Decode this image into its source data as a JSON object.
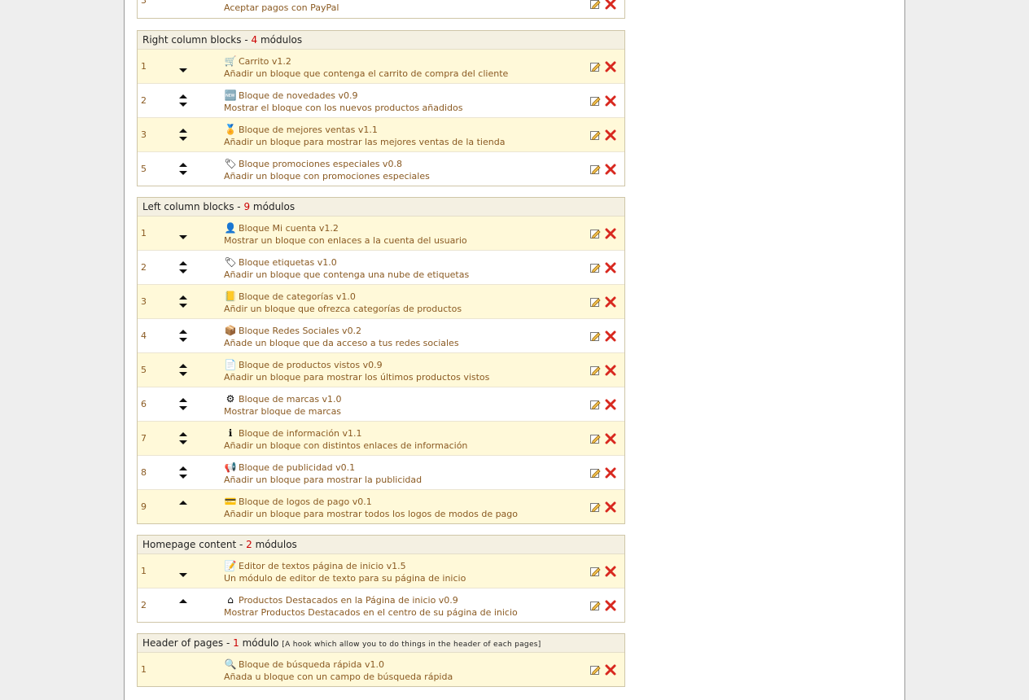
{
  "top_partial": {
    "position": "3",
    "description": "Aceptar pagos con PayPal"
  },
  "blocks": [
    {
      "title": "Right column blocks",
      "sep": " - ",
      "count": "4",
      "unit": "módulos",
      "hook_desc": "",
      "rows": [
        {
          "pos": "1",
          "icon": "cart-icon",
          "name": "Carrito v1.2",
          "desc": "Añadir un bloque que contenga el carrito de compra del cliente",
          "up": false,
          "down": true
        },
        {
          "pos": "2",
          "icon": "new-badge-icon",
          "name": "Bloque de novedades v0.9",
          "desc": "Mostrar el bloque con los nuevos productos añadidos",
          "up": true,
          "down": true
        },
        {
          "pos": "3",
          "icon": "award-icon",
          "name": "Bloque de mejores ventas v1.1",
          "desc": "Añadir un bloque para mostrar las mejores ventas de la tienda",
          "up": true,
          "down": true
        },
        {
          "pos": "5",
          "icon": "tag-icon",
          "name": "Bloque promociones especiales v0.8",
          "desc": "Añadir un bloque con promociones especiales",
          "up": true,
          "down": true
        }
      ]
    },
    {
      "title": "Left column blocks",
      "sep": " - ",
      "count": "9",
      "unit": "módulos",
      "hook_desc": "",
      "rows": [
        {
          "pos": "1",
          "icon": "user-icon",
          "name": "Bloque Mi cuenta v1.2",
          "desc": "Mostrar un bloque con enlaces a la cuenta del usuario",
          "up": false,
          "down": true
        },
        {
          "pos": "2",
          "icon": "tags-icon",
          "name": "Bloque etiquetas v1.0",
          "desc": "Añadir un bloque que contenga una nube de etiquetas",
          "up": true,
          "down": true
        },
        {
          "pos": "3",
          "icon": "catalog-icon",
          "name": "Bloque de categorías v1.0",
          "desc": "Añdir un bloque que ofrezca categorías de productos",
          "up": true,
          "down": true
        },
        {
          "pos": "4",
          "icon": "cube-icon",
          "name": "Bloque Redes Sociales v0.2",
          "desc": "Añade un bloque que da acceso a tus redes sociales",
          "up": true,
          "down": true
        },
        {
          "pos": "5",
          "icon": "viewed-doc-icon",
          "name": "Bloque de productos vistos v0.9",
          "desc": "Añadir un bloque para mostrar los últimos productos vistos",
          "up": true,
          "down": true
        },
        {
          "pos": "6",
          "icon": "gear-icon",
          "name": "Bloque de marcas v1.0",
          "desc": "Mostrar bloque de marcas",
          "up": true,
          "down": true
        },
        {
          "pos": "7",
          "icon": "info-icon",
          "name": "Bloque de información v1.1",
          "desc": "Añadir un bloque con distintos enlaces de información",
          "up": true,
          "down": true
        },
        {
          "pos": "8",
          "icon": "ad-icon",
          "name": "Bloque de publicidad v0.1",
          "desc": "Añadir un bloque para mostrar la publicidad",
          "up": true,
          "down": true
        },
        {
          "pos": "9",
          "icon": "payment-logos-icon",
          "name": "Bloque de logos de pago v0.1",
          "desc": "Añadir un bloque para mostrar todos los logos de modos de pago",
          "up": true,
          "down": false
        }
      ]
    },
    {
      "title": "Homepage content",
      "sep": " - ",
      "count": "2",
      "unit": "módulos",
      "hook_desc": "",
      "rows": [
        {
          "pos": "1",
          "icon": "text-editor-icon",
          "name": "Editor de textos página de inicio v1.5",
          "desc": "Un módulo de editor de texto para su página de inicio",
          "up": false,
          "down": true
        },
        {
          "pos": "2",
          "icon": "home-icon",
          "name": "Productos Destacados en la Página de inicio v0.9",
          "desc": "Mostrar Productos Destacados en el centro de su página de inicio",
          "up": true,
          "down": false
        }
      ]
    },
    {
      "title": "Header of pages",
      "sep": " - ",
      "count": "1",
      "unit": "módulo",
      "hook_desc": "[A hook which allow you to do things in the header of each pages]",
      "rows": [
        {
          "pos": "1",
          "icon": "search-icon",
          "name": "Bloque de búsqueda rápida v1.0",
          "desc": "Añada u bloque con un campo de búsqueda rápida",
          "up": false,
          "down": false
        }
      ]
    }
  ],
  "icons": {
    "cart-icon": "🛒",
    "new-badge-icon": "🆕",
    "award-icon": "🏅",
    "tag-icon": "🏷",
    "user-icon": "👤",
    "tags-icon": "🏷",
    "catalog-icon": "📒",
    "cube-icon": "📦",
    "viewed-doc-icon": "📄",
    "gear-icon": "⚙",
    "info-icon": "ℹ",
    "ad-icon": "📢",
    "payment-logos-icon": "💳",
    "text-editor-icon": "📝",
    "home-icon": "⌂",
    "search-icon": "🔍"
  },
  "colors": {
    "accent": "#cc0000",
    "link": "#8a5a22",
    "row_alt": "#fff9d9",
    "header_bg": "#f4f0e2"
  }
}
